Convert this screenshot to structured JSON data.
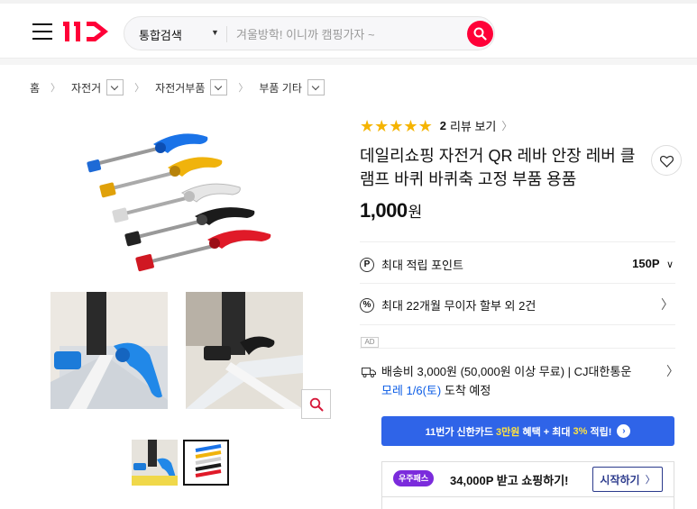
{
  "header": {
    "logo_text": "11",
    "search_scope": "통합검색",
    "search_placeholder": "겨울방학! 이니까 캠핑가자 ~"
  },
  "breadcrumb": [
    "홈",
    "자전거",
    "자전거부품",
    "부품 기타"
  ],
  "product": {
    "rating_stars": 5,
    "review_count": "2",
    "review_label": "리뷰 보기",
    "title": "데일리쇼핑 자전거 QR 레바 안장 레버 클램프 바퀴 바퀴축 고정 부품 용품",
    "price": "1,000",
    "price_unit": "원"
  },
  "benefits": {
    "points_icon": "P",
    "points_label": "최대 적립 포인트",
    "points_value": "150P",
    "installment_icon": "%",
    "installment_label": "최대 22개월 무이자 할부 외 2건"
  },
  "ad_badge": "AD",
  "shipping": {
    "line1": "배송비 3,000원 (50,000원 이상 무료) | CJ대한통운",
    "arrival_date": "모레 1/6(토)",
    "arrival_rest": "도착 예정"
  },
  "card_banner": {
    "pre": "11번가 신한카드 ",
    "highlight1": "3만원",
    "mid": " 혜택 + 최대 ",
    "highlight2": "3%",
    "post": " 적립!"
  },
  "pass": {
    "badge": "우주패스",
    "text": "34,000P 받고 쇼핑하기!",
    "button": "시작하기"
  },
  "colors": {
    "brand": "#ff0038",
    "star": "#f5b400",
    "banner": "#2f64e8",
    "arrival": "#0b5ce6",
    "pass": "#7b2bdc"
  }
}
